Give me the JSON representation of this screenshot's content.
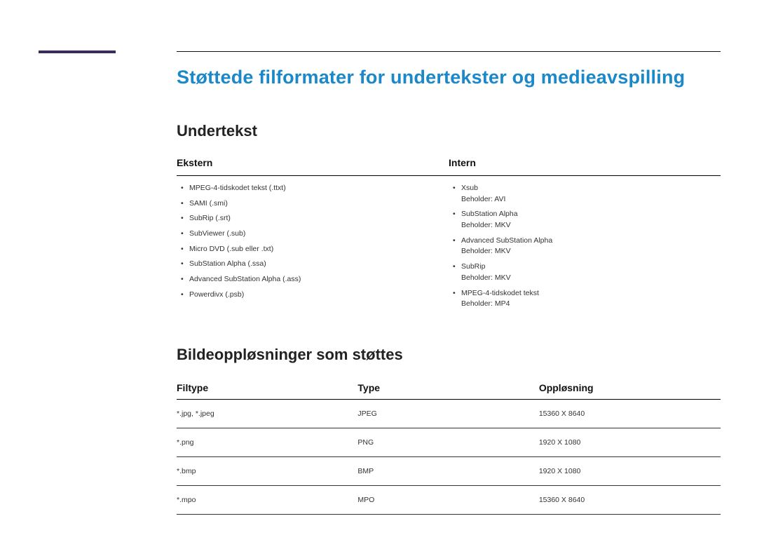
{
  "headings": {
    "main_title": "Støttede filformater for undertekster og medieavspilling",
    "subtitle_section": "Undertekst",
    "image_section": "Bildeoppløsninger som støttes"
  },
  "subtitle_columns": {
    "external_header": "Ekstern",
    "internal_header": "Intern",
    "external_items": [
      {
        "line": "MPEG-4-tidskodet tekst (.ttxt)"
      },
      {
        "line": "SAMI (.smi)"
      },
      {
        "line": "SubRip (.srt)"
      },
      {
        "line": "SubViewer (.sub)"
      },
      {
        "line": "Micro DVD (.sub eller .txt)"
      },
      {
        "line": "SubStation Alpha (.ssa)"
      },
      {
        "line": "Advanced SubStation Alpha (.ass)"
      },
      {
        "line": "Powerdivx (.psb)"
      }
    ],
    "internal_items": [
      {
        "line": "Xsub",
        "sub": "Beholder: AVI"
      },
      {
        "line": "SubStation Alpha",
        "sub": "Beholder: MKV"
      },
      {
        "line": "Advanced SubStation Alpha",
        "sub": "Beholder: MKV"
      },
      {
        "line": "SubRip",
        "sub": "Beholder: MKV"
      },
      {
        "line": "MPEG-4-tidskodet tekst",
        "sub": "Beholder: MP4"
      }
    ]
  },
  "image_table": {
    "headers": {
      "filetype": "Filtype",
      "type": "Type",
      "resolution": "Oppløsning"
    },
    "rows": [
      {
        "filetype": "*.jpg, *.jpeg",
        "type": "JPEG",
        "resolution": "15360 X 8640"
      },
      {
        "filetype": "*.png",
        "type": "PNG",
        "resolution": "1920 X 1080"
      },
      {
        "filetype": "*.bmp",
        "type": "BMP",
        "resolution": "1920 X 1080"
      },
      {
        "filetype": "*.mpo",
        "type": "MPO",
        "resolution": "15360 X 8640"
      }
    ]
  }
}
